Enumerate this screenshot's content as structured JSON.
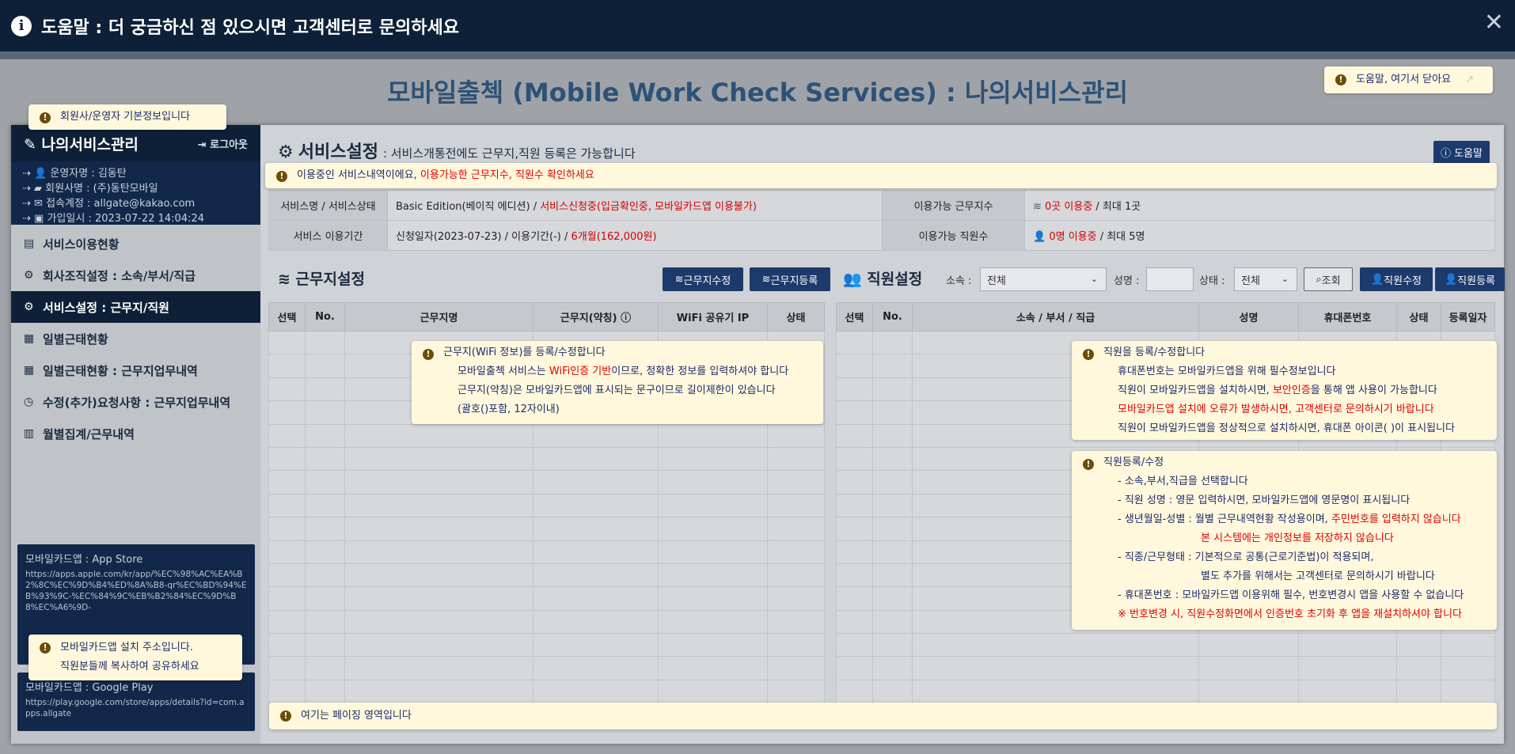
{
  "help_bar": {
    "title": "도움말 : 더 궁금하신 점 있으시면 고객센터로 문의하세요",
    "close": "✕"
  },
  "page_title": "모바일출첵 (Mobile Work Check Services) : 나의서비스관리",
  "tips": {
    "close_here": "도움말, 여기서 닫아요",
    "basic_info": "회원사/운영자 기본정보입니다",
    "service_info_a": "이용중인 서비스내역이에요, ",
    "service_info_b": "이용가능한 근무지수, 직원수 확인하세요",
    "app_url_1": "모바일카드앱 설치 주소입니다.",
    "app_url_2": "직원분들께 복사하여 공유하세요",
    "paging": "여기는 페이징 영역입니다",
    "workplace": {
      "l1": "근무지(WiFi 정보)를 등록/수정합니다",
      "l2a": "모바일출첵 서비스는 ",
      "l2b": "WiFi인증 기반",
      "l2c": "이므로, 정확한 정보를 입력하셔야 합니다",
      "l3": "근무지(약칭)은 모바일카드앱에 표시되는 문구이므로 길이제한이 있습니다",
      "l4": "(괄호()포함, 12자이내)"
    },
    "staff": {
      "l1": "직원을 등록/수정합니다",
      "l2": "휴대폰번호는 모바일카드앱을 위해 필수정보입니다",
      "l3a": "직원이 모바일카드앱을 설치하시면, ",
      "l3b": "보안인증",
      "l3c": "을 통해 앱 사용이 가능합니다",
      "l4": "모바일카드앱 설치에 오류가 발생하시면, 고객센터로 문의하시기 바랍니다",
      "l5": "직원이 모바일카드앱을 정상적으로 설치하시면, 휴대폰 아이콘(   )이 표시됩니다"
    },
    "staff_reg": {
      "l1": "직원등록/수정",
      "l2": "- 소속,부서,직급을 선택합니다",
      "l3": "- 직원 성명 : 영문 입력하시면, 모바일카드앱에 영문명이 표시됩니다",
      "l4a": "- 생년월일-성별 : 월별 근무내역현황 작성용이며, ",
      "l4b": "주민번호를 입력하지 않습니다",
      "l5": "본 시스템에는 개인정보를 저장하지 않습니다",
      "l6": "- 직종/근무형태 : 기본적으로 공통(근로기준법)이 적용되며,",
      "l7": "별도 추가를 위해서는 고객센터로 문의하시기 바랍니다",
      "l8": "- 휴대폰번호 : 모바일카드앱 이용위해 필수, 번호변경시 앱을 사용할 수 없습니다",
      "l9": "※ 번호변경 시, 직원수정화면에서 인증번호 초기화 후 앱을 재설치하셔야 합니다"
    }
  },
  "sidebar": {
    "title": "나의서비스관리",
    "logout": "로그아웃",
    "info": [
      "운영자명 : 김동탄",
      "회원사명 : (주)동탄모바일",
      "접속계정 : allgate@kakao.com",
      "가입일시 : 2023-07-22 14:04:24"
    ],
    "menu": [
      {
        "icon": "▤",
        "label": "서비스이용현황"
      },
      {
        "icon": "⚙",
        "label": "회사조직설정 : 소속/부서/직급"
      },
      {
        "icon": "⚙",
        "label": "서비스설정 : 근무지/직원"
      },
      {
        "icon": "▦",
        "label": "일별근태현황"
      },
      {
        "icon": "▦",
        "label": "일별근태현황 : 근무지업무내역"
      },
      {
        "icon": "◷",
        "label": "수정(추가)요청사항 : 근무지업무내역"
      },
      {
        "icon": "▥",
        "label": "월별집계/근무내역"
      }
    ],
    "app_store": {
      "label": "모바일카드앱 : App Store",
      "url": "https://apps.apple.com/kr/app/%EC%98%AC%EA%B2%8C%EC%9D%B4%ED%8A%B8-qr%EC%BD%94%EB%93%9C-%EC%84%9C%EB%B2%84%EC%9D%B8%EC%A6%9D-"
    },
    "google_play": {
      "label": "모바일카드앱 : Google Play",
      "url": "https://play.google.com/store/apps/details?id=com.apps.allgate"
    }
  },
  "service": {
    "title": "서비스설정",
    "subtitle": ": 서비스개통전에도 근무지,직원 등록은 가능합니다",
    "help_btn": "도움말",
    "rows": {
      "name_label": "서비스명 / 서비스상태",
      "name_value": "Basic Edition(베이직 에디션) / ",
      "name_status": "서비스신청중(입금확인중, 모바일카드앱 이용불가)",
      "wp_label": "이용가능 근무지수",
      "wp_used": "0곳 이용중",
      "wp_max": " / 최대 1곳",
      "period_label": "서비스 이용기간",
      "period_value": "신청일자(2023-07-23) / 이용기간(-) / ",
      "period_red": "6개월(162,000원)",
      "staff_label": "이용가능 직원수",
      "staff_used": "0명 이용중",
      "staff_max": " / 최대 5명"
    }
  },
  "workplace": {
    "title": "근무지설정",
    "edit_btn": "근무지수정",
    "add_btn": "근무지등록",
    "columns": [
      "선택",
      "No.",
      "근무지명",
      "근무지(약칭) ⓘ",
      "WiFi 공유기 IP",
      "상태"
    ]
  },
  "staff": {
    "title": "직원설정",
    "org_label": "소속 :",
    "org_value": "전체",
    "name_label": "성명 :",
    "status_label": "상태 :",
    "status_value": "전체",
    "search_btn": "조회",
    "edit_btn": "직원수정",
    "add_btn": "직원등록",
    "columns": [
      "선택",
      "No.",
      "소속 / 부서 / 직급",
      "성명",
      "휴대폰번호",
      "상태",
      "등록일자"
    ]
  }
}
